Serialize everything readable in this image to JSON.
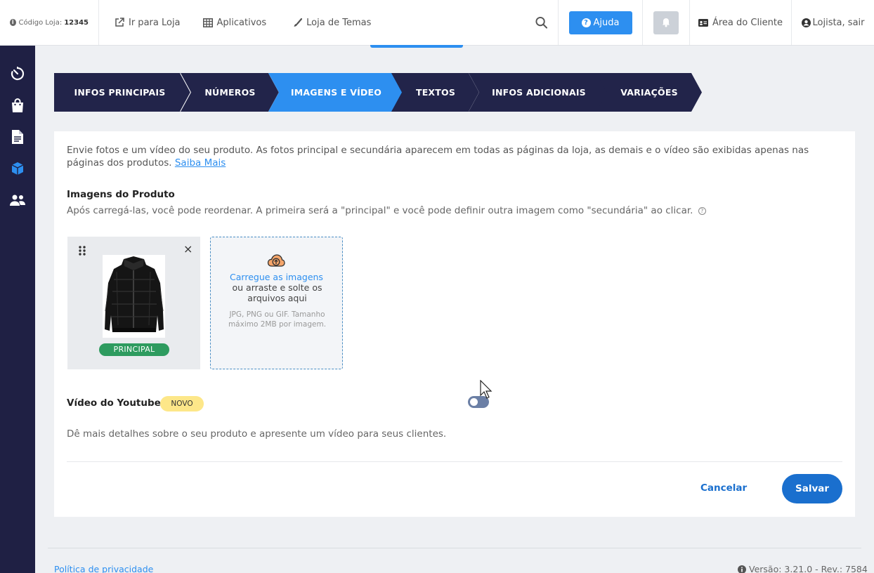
{
  "topbar": {
    "store_code_label": "Código Loja:",
    "store_code_value": "12345",
    "links": [
      {
        "label": "Ir para Loja",
        "icon": "external-link-icon"
      },
      {
        "label": "Aplicativos",
        "icon": "grid-icon"
      },
      {
        "label": "Loja de Temas",
        "icon": "brush-icon"
      }
    ],
    "help_label": "Ajuda",
    "client_area_label": "Área do Cliente",
    "user_label": "Lojista, sair"
  },
  "sidebar": {
    "items": [
      {
        "icon": "speedometer-icon",
        "active": false
      },
      {
        "icon": "shopping-bag-icon",
        "active": false
      },
      {
        "icon": "document-icon",
        "active": false
      },
      {
        "icon": "cube-icon",
        "active": true
      },
      {
        "icon": "users-icon",
        "active": false
      }
    ]
  },
  "steps": [
    {
      "label": "INFOS PRINCIPAIS",
      "active": false
    },
    {
      "label": "NÚMEROS",
      "active": false
    },
    {
      "label": "IMAGENS E VÍDEO",
      "active": true
    },
    {
      "label": "TEXTOS",
      "active": false
    },
    {
      "label": "INFOS ADICIONAIS",
      "active": false
    },
    {
      "label": "VARIAÇÕES",
      "active": false
    }
  ],
  "intro": {
    "text": "Envie fotos e um vídeo do seu produto. As fotos principal e secundária aparecem em todas as páginas da loja, as demais e o vídeo são exibidas apenas nas páginas dos produtos.",
    "link": "Saiba Mais"
  },
  "images": {
    "title": "Imagens do Produto",
    "description": "Após carregá-las, você pode reordenar. A primeira será a \"principal\" e você pode definir outra imagem como \"secundária\" ao clicar.",
    "principal_badge": "PRINCIPAL",
    "upload_link": "Carregue as imagens",
    "upload_text": "ou arraste e solte os arquivos aqui",
    "upload_hint": "JPG, PNG ou GIF. Tamanho máximo 2MB por imagem."
  },
  "video": {
    "title": "Vídeo do Youtube",
    "badge": "NOVO",
    "description": "Dê mais detalhes sobre o seu produto e apresente um vídeo para seus clientes.",
    "enabled": false
  },
  "actions": {
    "cancel": "Cancelar",
    "save": "Salvar"
  },
  "footer": {
    "privacy": "Política de privacidade",
    "version": "Versão: 3.21.0 - Rev.: 7584"
  },
  "colors": {
    "sidebar_bg": "#1f2044",
    "step_bg": "#22244a",
    "step_active": "#2d8ff0",
    "primary": "#1a6fce",
    "success": "#2e9b5f"
  }
}
